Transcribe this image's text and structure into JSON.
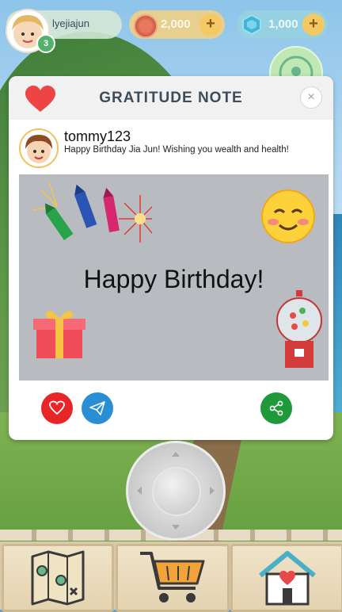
{
  "player": {
    "name": "lyejiajun",
    "level": "3"
  },
  "currencies": {
    "coins": "2,000",
    "gems": "1,000",
    "plus_label": "+"
  },
  "modal": {
    "title": "GRATITUDE NOTE",
    "close_label": "×",
    "sender_name": "tommy123",
    "message": "Happy Birthday Jia Jun! Wishing you wealth and health!",
    "card_text": "Happy Birthday!"
  },
  "colors": {
    "like": "#e8262a",
    "send": "#2a8ed4",
    "share": "#1f9a3a",
    "title": "#3e4c59"
  },
  "icons": {
    "like": "heart-icon",
    "send": "paper-plane-icon",
    "share": "share-icon",
    "close": "close-icon",
    "nav": [
      "treasure-map-icon",
      "shopping-cart-icon",
      "home-icon"
    ]
  }
}
